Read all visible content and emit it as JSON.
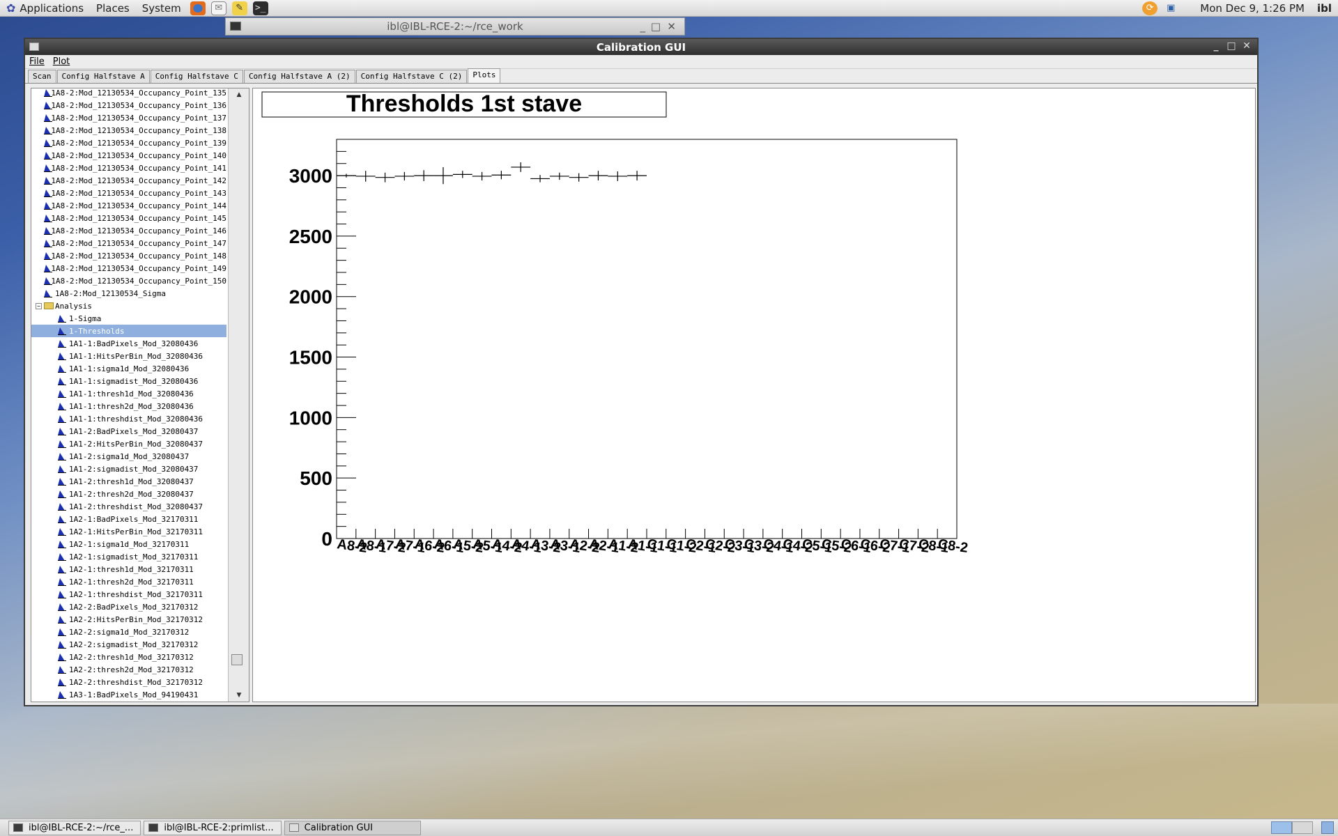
{
  "top_panel": {
    "menus": [
      "Applications",
      "Places",
      "System"
    ],
    "clock": "Mon Dec  9,  1:26 PM",
    "user": "ibl"
  },
  "back_terminal": {
    "title": "ibl@IBL-RCE-2:~/rce_work"
  },
  "window": {
    "title": "Calibration GUI",
    "menu": [
      "File",
      "Plot"
    ],
    "tabs": [
      "Scan",
      "Config Halfstave A",
      "Config Halfstave C",
      "Config Halfstave A (2)",
      "Config Halfstave C (2)",
      "Plots"
    ],
    "active_tab": "Plots"
  },
  "tree": {
    "items": [
      {
        "label": "1A8-2:Mod_12130534_Occupancy_Point_135",
        "level": 1
      },
      {
        "label": "1A8-2:Mod_12130534_Occupancy_Point_136",
        "level": 1
      },
      {
        "label": "1A8-2:Mod_12130534_Occupancy_Point_137",
        "level": 1
      },
      {
        "label": "1A8-2:Mod_12130534_Occupancy_Point_138",
        "level": 1
      },
      {
        "label": "1A8-2:Mod_12130534_Occupancy_Point_139",
        "level": 1
      },
      {
        "label": "1A8-2:Mod_12130534_Occupancy_Point_140",
        "level": 1
      },
      {
        "label": "1A8-2:Mod_12130534_Occupancy_Point_141",
        "level": 1
      },
      {
        "label": "1A8-2:Mod_12130534_Occupancy_Point_142",
        "level": 1
      },
      {
        "label": "1A8-2:Mod_12130534_Occupancy_Point_143",
        "level": 1
      },
      {
        "label": "1A8-2:Mod_12130534_Occupancy_Point_144",
        "level": 1
      },
      {
        "label": "1A8-2:Mod_12130534_Occupancy_Point_145",
        "level": 1
      },
      {
        "label": "1A8-2:Mod_12130534_Occupancy_Point_146",
        "level": 1
      },
      {
        "label": "1A8-2:Mod_12130534_Occupancy_Point_147",
        "level": 1
      },
      {
        "label": "1A8-2:Mod_12130534_Occupancy_Point_148",
        "level": 1
      },
      {
        "label": "1A8-2:Mod_12130534_Occupancy_Point_149",
        "level": 1
      },
      {
        "label": "1A8-2:Mod_12130534_Occupancy_Point_150",
        "level": 1
      },
      {
        "label": "1A8-2:Mod_12130534_Sigma",
        "level": 1
      },
      {
        "label": "Analysis",
        "level": 0,
        "folder": true
      },
      {
        "label": "1-Sigma",
        "level": 2
      },
      {
        "label": "1-Thresholds",
        "level": 2,
        "selected": true
      },
      {
        "label": "1A1-1:BadPixels_Mod_32080436",
        "level": 2
      },
      {
        "label": "1A1-1:HitsPerBin_Mod_32080436",
        "level": 2
      },
      {
        "label": "1A1-1:sigma1d_Mod_32080436",
        "level": 2
      },
      {
        "label": "1A1-1:sigmadist_Mod_32080436",
        "level": 2
      },
      {
        "label": "1A1-1:thresh1d_Mod_32080436",
        "level": 2
      },
      {
        "label": "1A1-1:thresh2d_Mod_32080436",
        "level": 2
      },
      {
        "label": "1A1-1:threshdist_Mod_32080436",
        "level": 2
      },
      {
        "label": "1A1-2:BadPixels_Mod_32080437",
        "level": 2
      },
      {
        "label": "1A1-2:HitsPerBin_Mod_32080437",
        "level": 2
      },
      {
        "label": "1A1-2:sigma1d_Mod_32080437",
        "level": 2
      },
      {
        "label": "1A1-2:sigmadist_Mod_32080437",
        "level": 2
      },
      {
        "label": "1A1-2:thresh1d_Mod_32080437",
        "level": 2
      },
      {
        "label": "1A1-2:thresh2d_Mod_32080437",
        "level": 2
      },
      {
        "label": "1A1-2:threshdist_Mod_32080437",
        "level": 2
      },
      {
        "label": "1A2-1:BadPixels_Mod_32170311",
        "level": 2
      },
      {
        "label": "1A2-1:HitsPerBin_Mod_32170311",
        "level": 2
      },
      {
        "label": "1A2-1:sigma1d_Mod_32170311",
        "level": 2
      },
      {
        "label": "1A2-1:sigmadist_Mod_32170311",
        "level": 2
      },
      {
        "label": "1A2-1:thresh1d_Mod_32170311",
        "level": 2
      },
      {
        "label": "1A2-1:thresh2d_Mod_32170311",
        "level": 2
      },
      {
        "label": "1A2-1:threshdist_Mod_32170311",
        "level": 2
      },
      {
        "label": "1A2-2:BadPixels_Mod_32170312",
        "level": 2
      },
      {
        "label": "1A2-2:HitsPerBin_Mod_32170312",
        "level": 2
      },
      {
        "label": "1A2-2:sigma1d_Mod_32170312",
        "level": 2
      },
      {
        "label": "1A2-2:sigmadist_Mod_32170312",
        "level": 2
      },
      {
        "label": "1A2-2:thresh1d_Mod_32170312",
        "level": 2
      },
      {
        "label": "1A2-2:thresh2d_Mod_32170312",
        "level": 2
      },
      {
        "label": "1A2-2:threshdist_Mod_32170312",
        "level": 2
      },
      {
        "label": "1A3-1:BadPixels_Mod_94190431",
        "level": 2
      }
    ]
  },
  "chart_data": {
    "type": "scatter",
    "title": "Thresholds 1st stave",
    "xlabel": "",
    "ylabel": "",
    "ylim": [
      0,
      3300
    ],
    "yticks": [
      0,
      500,
      1000,
      1500,
      2000,
      2500,
      3000
    ],
    "categories": [
      "A8-2",
      "A8-1",
      "A7-2",
      "A7-1",
      "A6-2",
      "A6-1",
      "A5-2",
      "A5-1",
      "A4-2",
      "A4-1",
      "A3-2",
      "A3-1",
      "A2-2",
      "A2-1",
      "A1-2",
      "A1-1",
      "C1-1",
      "C1-2",
      "C2-1",
      "C2-2",
      "C3-1",
      "C3-2",
      "C4-1",
      "C4-2",
      "C5-1",
      "C5-2",
      "C6-1",
      "C6-2",
      "C7-1",
      "C7-2",
      "C8-1",
      "C8-2"
    ],
    "series": [
      {
        "values": [
          3000,
          2995,
          2985,
          2995,
          3000,
          3000,
          3010,
          2995,
          3005,
          3070,
          2975,
          2995,
          2985,
          3000,
          2995,
          3000,
          null,
          null,
          null,
          null,
          null,
          null,
          null,
          null,
          null,
          null,
          null,
          null,
          null,
          null,
          null,
          null
        ],
        "errors": [
          15,
          45,
          40,
          35,
          45,
          70,
          30,
          35,
          35,
          40,
          30,
          30,
          35,
          40,
          40,
          40,
          null,
          null,
          null,
          null,
          null,
          null,
          null,
          null,
          null,
          null,
          null,
          null,
          null,
          null,
          null,
          null
        ]
      }
    ],
    "grid": false
  },
  "taskbar": {
    "tasks": [
      "ibl@IBL-RCE-2:~/rce_...",
      "ibl@IBL-RCE-2:primlist...",
      "Calibration GUI"
    ],
    "active": "Calibration GUI"
  }
}
